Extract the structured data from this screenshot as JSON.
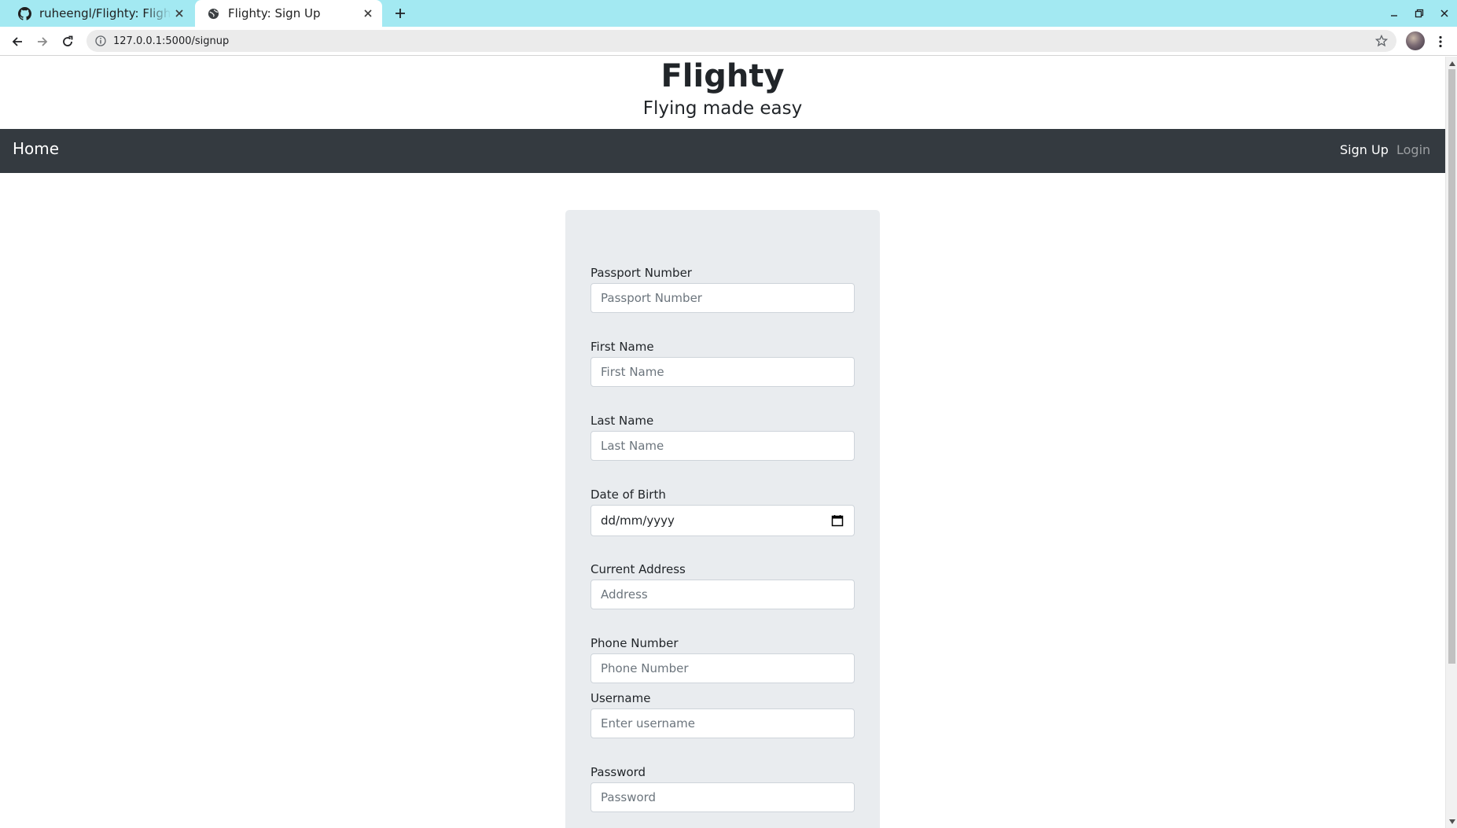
{
  "browser": {
    "tabs": [
      {
        "title": "ruheengl/Flighty: Flight Management",
        "favicon": "github-icon"
      },
      {
        "title": "Flighty: Sign Up",
        "favicon": "globe-icon"
      }
    ],
    "url": "127.0.0.1:5000/signup"
  },
  "site": {
    "title": "Flighty",
    "subtitle": "Flying made easy"
  },
  "nav": {
    "home": "Home",
    "signup": "Sign Up",
    "login": "Login"
  },
  "form": {
    "fields": [
      {
        "label": "Passport Number",
        "placeholder": "Passport Number"
      },
      {
        "label": "First Name",
        "placeholder": "First Name"
      },
      {
        "label": "Last Name",
        "placeholder": "Last Name"
      },
      {
        "label": "Date of Birth",
        "placeholder": "dd/mm/yyyy"
      },
      {
        "label": "Current Address",
        "placeholder": "Address"
      },
      {
        "label": "Phone Number",
        "placeholder": "Phone Number"
      },
      {
        "label": "Username",
        "placeholder": "Enter username"
      },
      {
        "label": "Password",
        "placeholder": "Password"
      }
    ]
  },
  "colors": {
    "tabbar": "#a3e9f2",
    "navbar": "#343a40",
    "card": "#e9ecef"
  }
}
